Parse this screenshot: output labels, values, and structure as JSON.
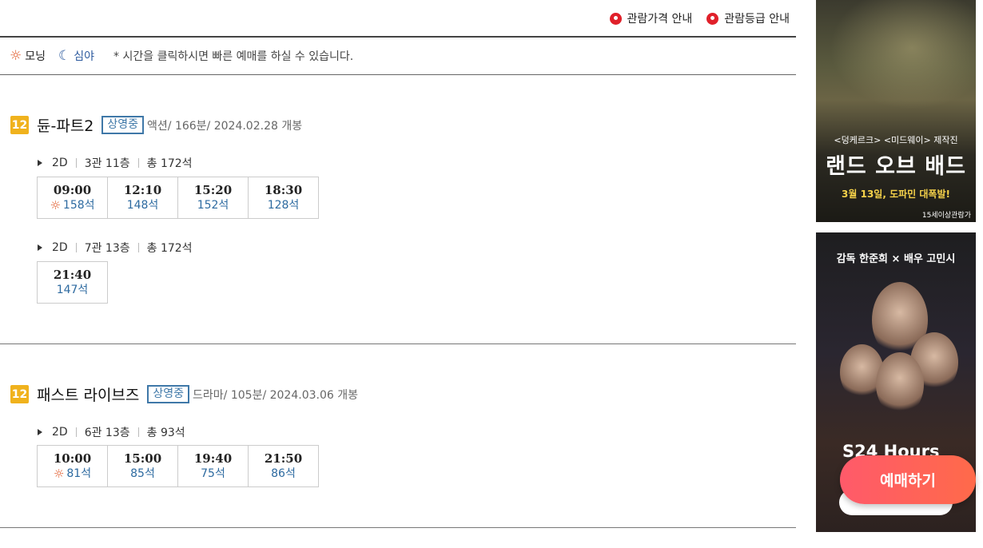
{
  "top_links": {
    "price_guide": "관람가격 안내",
    "rating_guide": "관람등급 안내"
  },
  "legend": {
    "morning": "모닝",
    "late_night": "심야",
    "note": "* 시간을 클릭하시면 빠른 예매를 하실 수 있습니다."
  },
  "movies": [
    {
      "age": "12",
      "title": "듄-파트2",
      "status": "상영중",
      "meta": "액션/ 166분/ 2024.02.28 개봉",
      "halls": [
        {
          "format": "2D",
          "hall": "3관 11층",
          "total": "총 172석",
          "times": [
            {
              "time": "09:00",
              "seats": "158석",
              "morning": true
            },
            {
              "time": "12:10",
              "seats": "148석",
              "morning": false
            },
            {
              "time": "15:20",
              "seats": "152석",
              "morning": false
            },
            {
              "time": "18:30",
              "seats": "128석",
              "morning": false
            }
          ]
        },
        {
          "format": "2D",
          "hall": "7관 13층",
          "total": "총 172석",
          "times": [
            {
              "time": "21:40",
              "seats": "147석",
              "morning": false
            }
          ]
        }
      ]
    },
    {
      "age": "12",
      "title": "패스트 라이브즈",
      "status": "상영중",
      "meta": "드라마/ 105분/ 2024.03.06 개봉",
      "halls": [
        {
          "format": "2D",
          "hall": "6관 13층",
          "total": "총 93석",
          "times": [
            {
              "time": "10:00",
              "seats": "81석",
              "morning": true
            },
            {
              "time": "15:00",
              "seats": "85석",
              "morning": false
            },
            {
              "time": "19:40",
              "seats": "75석",
              "morning": false
            },
            {
              "time": "21:50",
              "seats": "86석",
              "morning": false
            }
          ]
        }
      ]
    }
  ],
  "ads": {
    "ad1": {
      "tagline": "<덩케르크> <미드웨이> 제작진",
      "headline": "랜드 오브 배드",
      "sub": "3월 13일, 도파민 대폭발!",
      "rating": "15세이상관람가"
    },
    "ad2": {
      "credit": "감독 한준희 × 배우 고민시",
      "title": "S24 Hours"
    }
  },
  "reserve_button": "예매하기",
  "icons": {
    "morning": "sun-icon",
    "late_night": "moon-icon",
    "link": "location-pin-icon"
  },
  "colors": {
    "age_badge": "#f0b21d",
    "status": "#3f78a8",
    "seats": "#2d6aa0",
    "sun": "#e05a2a",
    "reserve_button": "#ff5a6a"
  }
}
